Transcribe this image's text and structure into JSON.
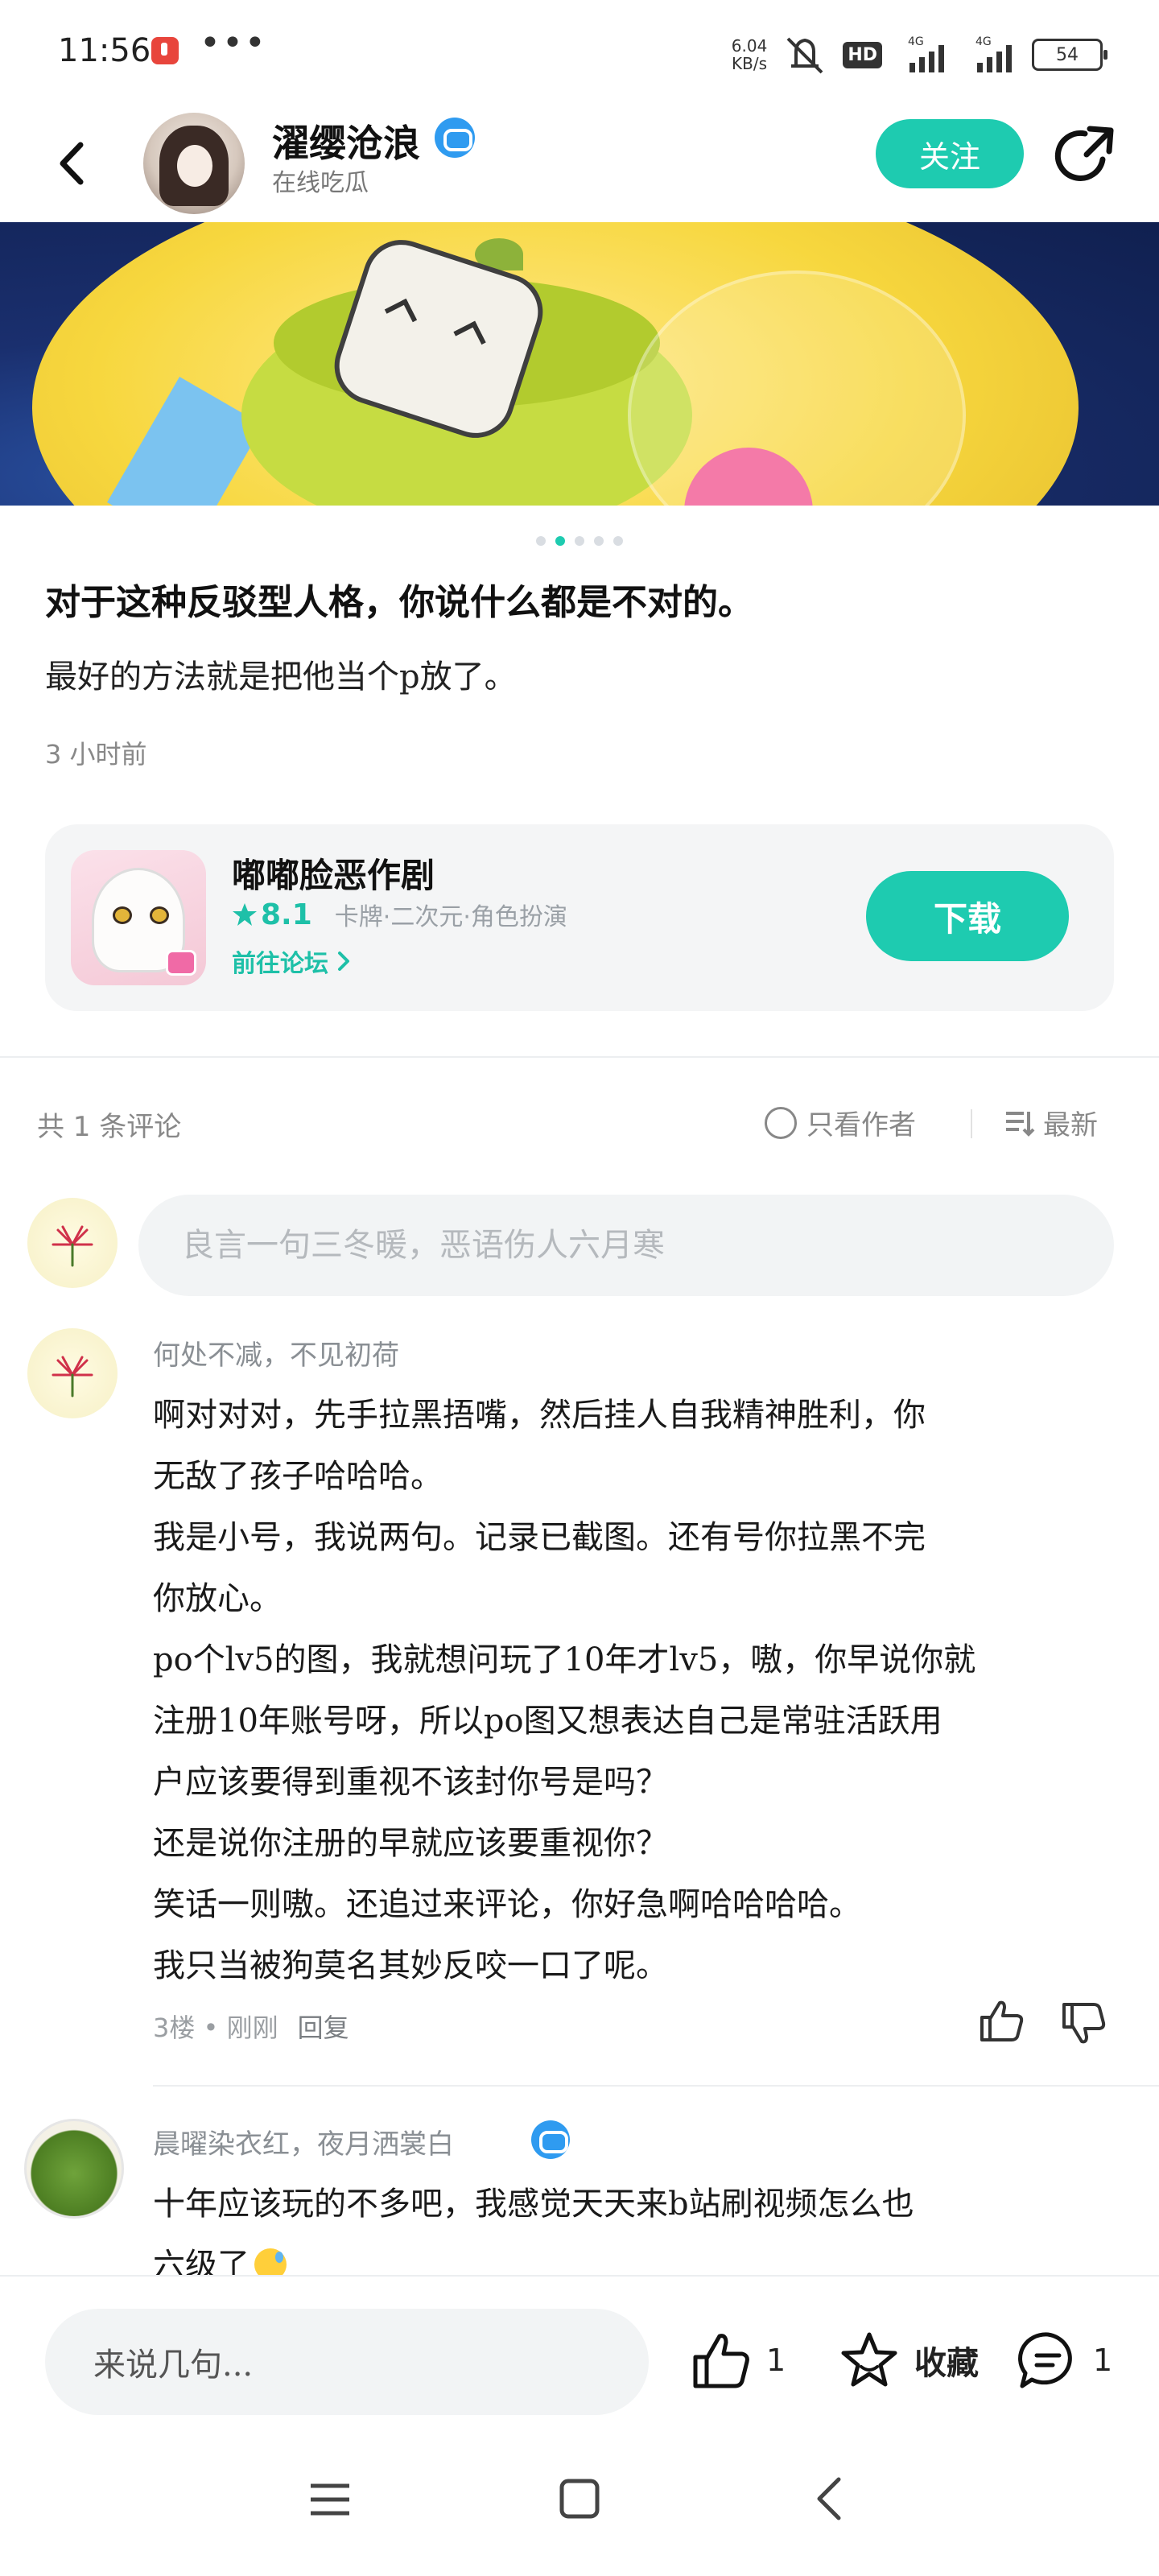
{
  "status_bar": {
    "time": "11:56",
    "net_speed_value": "6.04",
    "net_speed_unit": "KB/s",
    "hd_label": "HD",
    "network_1": "4G",
    "network_2": "4G",
    "battery": "54",
    "icons": [
      "music-app-icon",
      "more-dots-icon",
      "mute-icon",
      "signal-icon",
      "battery-icon"
    ]
  },
  "header": {
    "user_name": "濯缨沧浪",
    "user_status": "在线吃瓜",
    "follow_label": "关注",
    "icons": [
      "back-icon",
      "verified-icon",
      "share-icon"
    ]
  },
  "carousel": {
    "dot_count": 5,
    "active_index": 1
  },
  "post": {
    "title": "对于这种反驳型人格，你说什么都是不对的。",
    "body": "最好的方法就是把他当个p放了。",
    "time": "3 小时前"
  },
  "app_card": {
    "name": "嘟嘟脸恶作剧",
    "rating": "8.1",
    "tags": "卡牌·二次元·角色扮演",
    "forum_link": "前往论坛",
    "download_label": "下载"
  },
  "comments_header": {
    "count_text": "共 1 条评论",
    "author_only_label": "只看作者",
    "sort_label": "最新"
  },
  "comment_input": {
    "placeholder": "良言一句三冬暖，恶语伤人六月寒"
  },
  "comments": [
    {
      "author": "何处不减，不见初荷",
      "lines": [
        "啊对对对，先手拉黑捂嘴，然后挂人自我精神胜利，你",
        "无敌了孩子哈哈哈。",
        "我是小号，我说两句。记录已截图。还有号你拉黑不完",
        "你放心。",
        "po个lv5的图，我就想问玩了10年才lv5，嗷，你早说你就",
        "注册10年账号呀，所以po图又想表达自己是常驻活跃用",
        "户应该要得到重视不该封你号是吗？",
        "还是说你注册的早就应该要重视你？",
        "笑话一则嗷。还追过来评论，你好急啊哈哈哈哈。",
        "我只当被狗莫名其妙反咬一口了呢。"
      ],
      "floor": "3楼",
      "time": "刚刚",
      "reply_label": "回复"
    },
    {
      "author": "晨曜染衣红，夜月洒裳白",
      "lines": [
        "十年应该玩的不多吧，我感觉天天来b站刷视频怎么也",
        "六级了"
      ]
    }
  ],
  "bottom_bar": {
    "reply_placeholder": "来说几句...",
    "like_count": "1",
    "fav_label": "收藏",
    "comment_count": "1"
  },
  "nav_bar": {
    "icons": [
      "menu-icon",
      "home-icon",
      "back-nav-icon"
    ]
  },
  "colors": {
    "accent": "#1ecbb0",
    "verified": "#2f9bf0",
    "muted_text": "#888888"
  }
}
